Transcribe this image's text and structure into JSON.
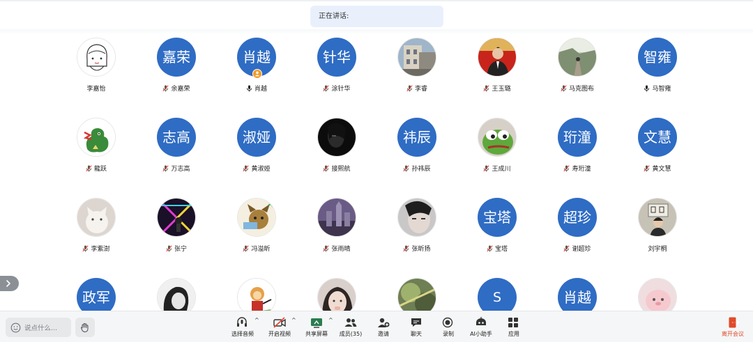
{
  "speaking_bar": {
    "label": "正在讲话:"
  },
  "participants": [
    {
      "name": "李嘉怡",
      "mic": "none",
      "avatar_type": "image",
      "avatar_desc": "cartoon-girl"
    },
    {
      "name": "余嘉荣",
      "mic": "muted",
      "avatar_type": "text",
      "avatar_text": "嘉荣"
    },
    {
      "name": "肖越",
      "mic": "on",
      "avatar_type": "text",
      "avatar_text": "肖越",
      "host": true
    },
    {
      "name": "涂针华",
      "mic": "muted",
      "avatar_type": "text",
      "avatar_text": "针华"
    },
    {
      "name": "李睿",
      "mic": "muted",
      "avatar_type": "image",
      "avatar_desc": "building-photo"
    },
    {
      "name": "王玉璐",
      "mic": "muted",
      "avatar_type": "image",
      "avatar_desc": "man-in-suit"
    },
    {
      "name": "马克图布",
      "mic": "muted",
      "avatar_type": "image",
      "avatar_desc": "forest-path"
    },
    {
      "name": "马智雍",
      "mic": "on",
      "avatar_type": "text",
      "avatar_text": "智雍"
    },
    {
      "name": "龍跃",
      "mic": "muted",
      "avatar_type": "image",
      "avatar_desc": "green-dragon"
    },
    {
      "name": "万志高",
      "mic": "muted",
      "avatar_type": "text",
      "avatar_text": "志高"
    },
    {
      "name": "黄淑娅",
      "mic": "muted",
      "avatar_type": "text",
      "avatar_text": "淑娅"
    },
    {
      "name": "接熙航",
      "mic": "muted",
      "avatar_type": "image",
      "avatar_desc": "dark-portrait"
    },
    {
      "name": "孙祎辰",
      "mic": "muted",
      "avatar_type": "text",
      "avatar_text": "祎辰"
    },
    {
      "name": "王成川",
      "mic": "muted",
      "avatar_type": "image",
      "avatar_desc": "pepe-frog"
    },
    {
      "name": "寿珩潼",
      "mic": "muted",
      "avatar_type": "text",
      "avatar_text": "珩潼"
    },
    {
      "name": "黄文慧",
      "mic": "muted",
      "avatar_type": "text",
      "avatar_text": "文慧"
    },
    {
      "name": "李紫澍",
      "mic": "muted",
      "avatar_type": "image",
      "avatar_desc": "white-cat"
    },
    {
      "name": "张宁",
      "mic": "muted",
      "avatar_type": "image",
      "avatar_desc": "neon-stage"
    },
    {
      "name": "冯溢昕",
      "mic": "muted",
      "avatar_type": "image",
      "avatar_desc": "cartoon-dog"
    },
    {
      "name": "张雨晴",
      "mic": "muted",
      "avatar_type": "image",
      "avatar_desc": "castle-night"
    },
    {
      "name": "张昕扬",
      "mic": "muted",
      "avatar_type": "image",
      "avatar_desc": "person-closeup"
    },
    {
      "name": "宝塔",
      "mic": "muted",
      "avatar_type": "text",
      "avatar_text": "宝塔"
    },
    {
      "name": "谢超珍",
      "mic": "muted",
      "avatar_type": "text",
      "avatar_text": "超珍"
    },
    {
      "name": "刘宇桐",
      "mic": "none",
      "avatar_type": "image",
      "avatar_desc": "girl-sign"
    },
    {
      "name": "",
      "mic": "none",
      "avatar_type": "text",
      "avatar_text": "政军"
    },
    {
      "name": "",
      "mic": "none",
      "avatar_type": "image",
      "avatar_desc": "bw-portrait"
    },
    {
      "name": "",
      "mic": "none",
      "avatar_type": "image",
      "avatar_desc": "cartoon-monkey"
    },
    {
      "name": "",
      "mic": "none",
      "avatar_type": "image",
      "avatar_desc": "girl-closeup"
    },
    {
      "name": "",
      "mic": "none",
      "avatar_type": "image",
      "avatar_desc": "green-blur"
    },
    {
      "name": "",
      "mic": "none",
      "avatar_type": "text",
      "avatar_text": "S"
    },
    {
      "name": "",
      "mic": "none",
      "avatar_type": "text",
      "avatar_text": "肖越"
    },
    {
      "name": "",
      "mic": "none",
      "avatar_type": "image",
      "avatar_desc": "pink-toy"
    }
  ],
  "toolbar": {
    "chat_placeholder": "说点什么...",
    "items": [
      {
        "label": "选择音频",
        "icon": "headset-mic-icon"
      },
      {
        "label": "开启视频",
        "icon": "camera-off-icon"
      },
      {
        "label": "共享屏幕",
        "icon": "share-screen-icon"
      },
      {
        "label": "成员(35)",
        "icon": "members-icon"
      },
      {
        "label": "邀请",
        "icon": "invite-icon"
      },
      {
        "label": "聊天",
        "icon": "chat-icon"
      },
      {
        "label": "录制",
        "icon": "record-icon"
      },
      {
        "label": "AI小助手",
        "icon": "ai-assistant-icon"
      },
      {
        "label": "应用",
        "icon": "apps-icon"
      }
    ],
    "leave_label": "离开会议"
  },
  "colors": {
    "avatar_blue": "#2f6cc4",
    "mute_red": "#e5432f",
    "leave_red": "#e04b2a",
    "host_badge": "#f59a23"
  }
}
